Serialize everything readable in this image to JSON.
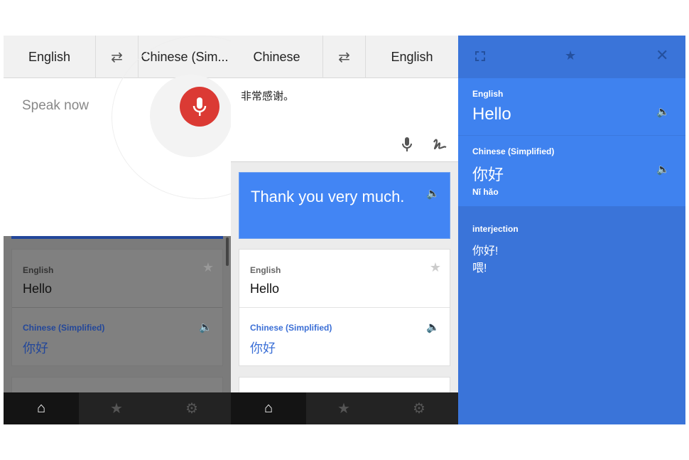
{
  "colors": {
    "accent_blue": "#4285f4",
    "mic_red": "#db3a34",
    "nav_bg": "#232323"
  },
  "left": {
    "header": {
      "source": "English",
      "swap_icon": "swap-arrows-icon",
      "target": "Chinese (Sim..."
    },
    "prompt": "Speak now",
    "card": {
      "source_lang": "English",
      "source_text": "Hello",
      "target_lang": "Chinese (Simplified)",
      "target_text": "你好"
    },
    "nav": [
      "home-icon",
      "star-icon",
      "gear-icon"
    ]
  },
  "middle": {
    "header": {
      "source": "Chinese",
      "swap_icon": "swap-arrows-icon",
      "target": "English"
    },
    "input_text": "非常感谢。",
    "translation": "Thank you very much.",
    "card": {
      "source_lang": "English",
      "source_text": "Hello",
      "target_lang": "Chinese (Simplified)",
      "target_text": "你好"
    },
    "nav": [
      "home-icon",
      "star-icon",
      "gear-icon"
    ]
  },
  "right": {
    "source_lang": "English",
    "source_text": "Hello",
    "target_lang": "Chinese (Simplified)",
    "target_text": "你好",
    "romanization": "Nǐ hǎo",
    "pos": "interjection",
    "alternatives": [
      "你好!",
      "喂!"
    ]
  }
}
